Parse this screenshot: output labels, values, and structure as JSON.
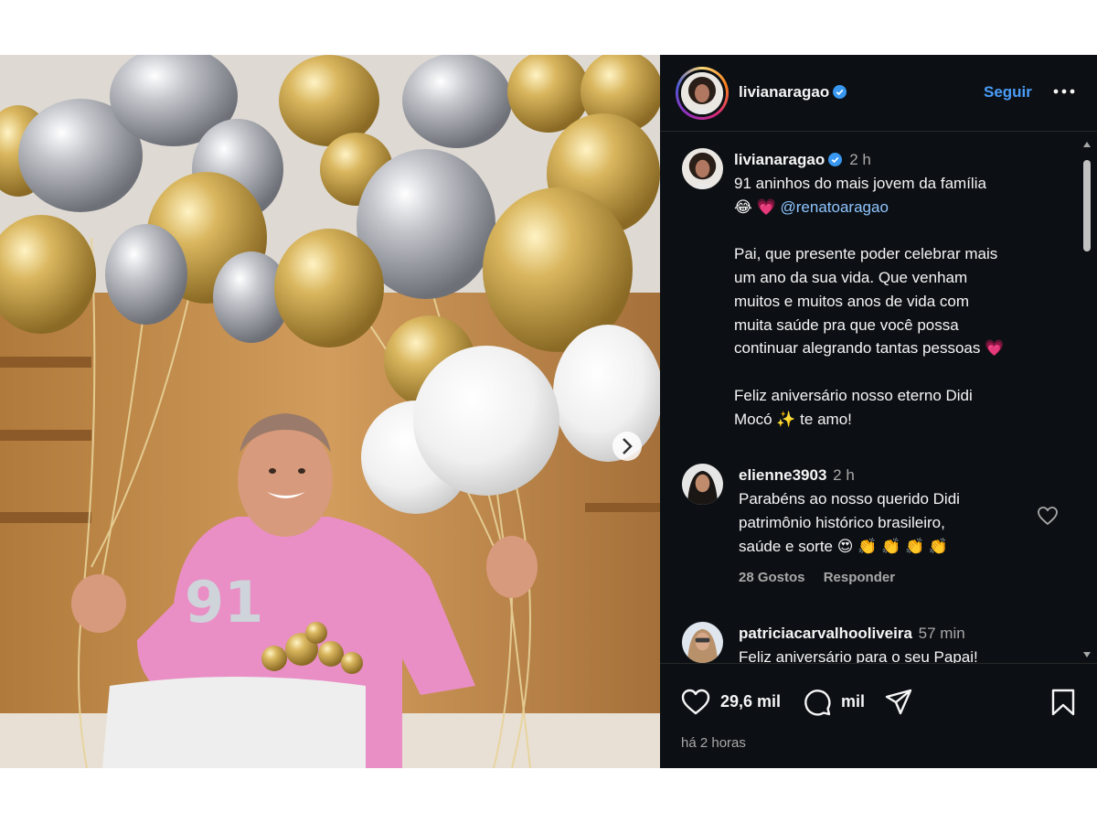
{
  "post": {
    "username": "livianaragao",
    "follow_label": "Seguir",
    "caption": {
      "time": "2 h",
      "line1": "91 aninhos do mais jovem da família",
      "line2_emoji": "😂 💗",
      "mention": "@renatoaragao",
      "para2": [
        "Pai, que presente poder celebrar mais",
        "um ano da sua vida. Que venham",
        "muitos e muitos anos de vida com",
        "muita saúde pra que você possa",
        "continuar alegrando tantas pessoas 💗"
      ],
      "para3": [
        "Feliz aniversário nosso eterno Didi",
        "Mocó ✨ te amo!"
      ]
    },
    "comments": [
      {
        "user": "elienne3903",
        "time": "2 h",
        "lines": [
          "Parabéns ao nosso querido Didi",
          "patrimônio histórico brasileiro,",
          "saúde e sorte 😍 👏 👏 👏 👏"
        ],
        "likes": "28 Gostos",
        "reply": "Responder"
      },
      {
        "user": "patriciacarvalhooliveira",
        "time": "57 min",
        "lines": [
          "Feliz aniversário para o seu Papai!"
        ]
      }
    ],
    "like_count": "29,6 mil",
    "comment_count": "mil",
    "posted_ago": "há 2 horas"
  },
  "colors": {
    "panel_bg": "#0c1014",
    "accent": "#4a9df8",
    "text": "#f5f5f5",
    "muted": "#a8a8a8"
  },
  "icons": [
    "verified-badge-icon",
    "more-options-icon",
    "heart-icon",
    "comment-icon",
    "share-icon",
    "bookmark-icon",
    "next-arrow-icon"
  ]
}
